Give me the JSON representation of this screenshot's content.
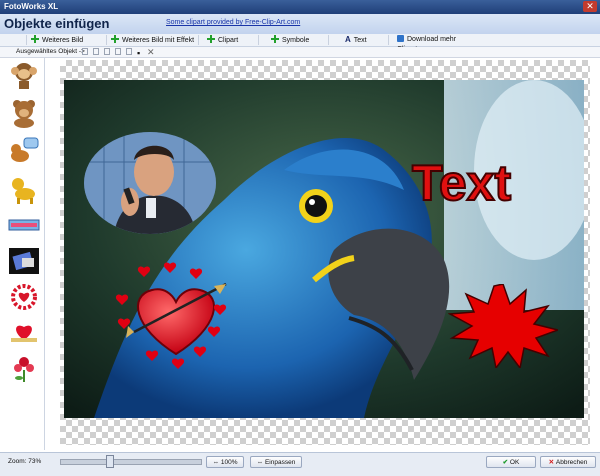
{
  "window": {
    "title": "FotoWorks XL"
  },
  "header": {
    "title": "Objekte einfügen",
    "credit_link": "Some clipart provided by Free-Clip-Art.com"
  },
  "toolbar": {
    "items": [
      {
        "label": "Weiteres Bild",
        "icon": "plus-icon"
      },
      {
        "label": "Weiteres Bild mit Effekt",
        "icon": "plus-icon"
      },
      {
        "label": "Clipart",
        "icon": "plus-icon"
      },
      {
        "label": "Symbole",
        "icon": "plus-icon"
      },
      {
        "label": "Text",
        "icon": "text-A-icon"
      },
      {
        "label": "Download mehr Cliparts",
        "icon": "download-icon"
      }
    ]
  },
  "subtoolbar": {
    "selected_label": "Ausgewähltes Objekt ->"
  },
  "sidebar": {
    "cliparts": [
      "monkey-clipart-icon",
      "bear-clipart-icon",
      "dog-sign-clipart-icon",
      "yellow-dog-clipart-icon",
      "banner-clipart-icon",
      "gift-card-clipart-icon",
      "hearts-wreath-clipart-icon",
      "heart-ribbon-clipart-icon",
      "rose-hearts-clipart-icon"
    ]
  },
  "canvas": {
    "text_object": "Text"
  },
  "statusbar": {
    "zoom_label": "Zoom: 73%",
    "zoom_value": 0.73,
    "btn_100": "100%",
    "btn_fit": "Einpassen",
    "ok": "OK",
    "cancel": "Abbrechen"
  },
  "colors": {
    "accent": "#23a02c",
    "text_red": "#e01010",
    "title_bar": "#2a4c88"
  }
}
